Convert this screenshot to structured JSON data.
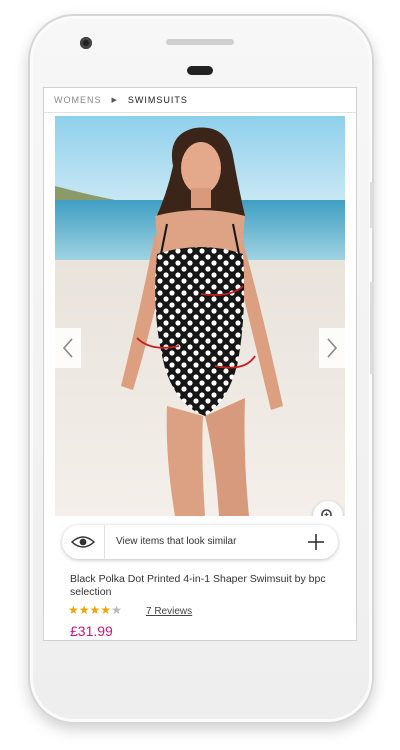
{
  "breadcrumb": {
    "items": [
      "WOMENS",
      "SWIMSUITS"
    ]
  },
  "product": {
    "title": "Black Polka Dot Printed 4-in-1 Shaper Swimsuit by bpc selection",
    "rating": 4.5,
    "rating_max": 5,
    "reviews_label": "7  Reviews",
    "price": "£31.99"
  },
  "similar": {
    "label": "View items that look similar"
  },
  "icons": {
    "prev": "chevron-left-icon",
    "next": "chevron-right-icon",
    "zoom": "zoom-in-icon",
    "eye": "eye-icon",
    "add": "plus-icon"
  },
  "colors": {
    "price": "#d0147c",
    "star": "#f0a500",
    "star_empty": "#b9b9b9"
  }
}
